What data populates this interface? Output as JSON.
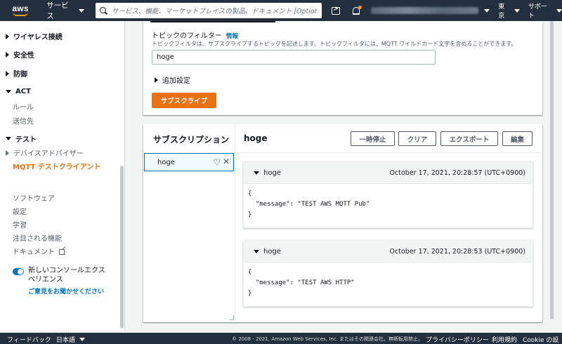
{
  "topnav": {
    "logo": "aws",
    "services_label": "サービス",
    "search_placeholder": "サービス、機能、マーケットプレイスの製品、ドキュメント [Option+S]",
    "region_label": "東京",
    "support_label": "サポート"
  },
  "sidebar": {
    "items": [
      {
        "label": "ワイヤレス接続"
      },
      {
        "label": "安全性"
      },
      {
        "label": "防御"
      }
    ],
    "act": {
      "label": "ACT",
      "children": [
        "ルール",
        "送信先"
      ]
    },
    "test": {
      "label": "テスト",
      "advisor": "デバイスアドバイザー",
      "mqtt": "MQTT テストクライアント"
    },
    "links": [
      "ソフトウェア",
      "設定",
      "学習",
      "注目される機能",
      "ドキュメント"
    ],
    "new_experience": "新しいコンソールエクスペリエンス",
    "feedback": "ご意見をお聞かせください"
  },
  "filter": {
    "label": "トピックのフィルター",
    "info": "情報",
    "description": "トピックフィルタは、サブスクライブするトピックを記述します。トピックフィルタには、MQTT ワイルドカード文字を含めることができます。",
    "value": "hoge",
    "additional": "追加設定",
    "subscribe_button": "サブスクライブ"
  },
  "subscriptions": {
    "title": "サブスクリプション",
    "items": [
      {
        "topic": "hoge"
      }
    ]
  },
  "topic_view": {
    "title": "hoge",
    "buttons": {
      "pause": "一時停止",
      "clear": "クリア",
      "export": "エクスポート",
      "edit": "編集"
    },
    "messages": [
      {
        "topic": "hoge",
        "time": "October 17, 2021, 20:28:57 (UTC+0900)",
        "body": "{\n  \"message\": \"TEST AWS MQTT Pub\"\n}"
      },
      {
        "topic": "hoge",
        "time": "October 17, 2021, 20:28:53 (UTC+0900)",
        "body": "{\n  \"message\": \"TEST AWS HTTP\"\n}"
      }
    ]
  },
  "footer": {
    "feedback": "フィードバック",
    "language": "日本語",
    "copyright": "© 2008 - 2021, Amazon Web Services, Inc. またはその関連会社。無断転用禁止。",
    "privacy": "プライバシーポリシー",
    "terms": "利用規約",
    "cookie": "Cookie の設定"
  },
  "colors": {
    "nav_bg": "#232f3e",
    "accent": "#ec7211",
    "link": "#0073bb"
  }
}
